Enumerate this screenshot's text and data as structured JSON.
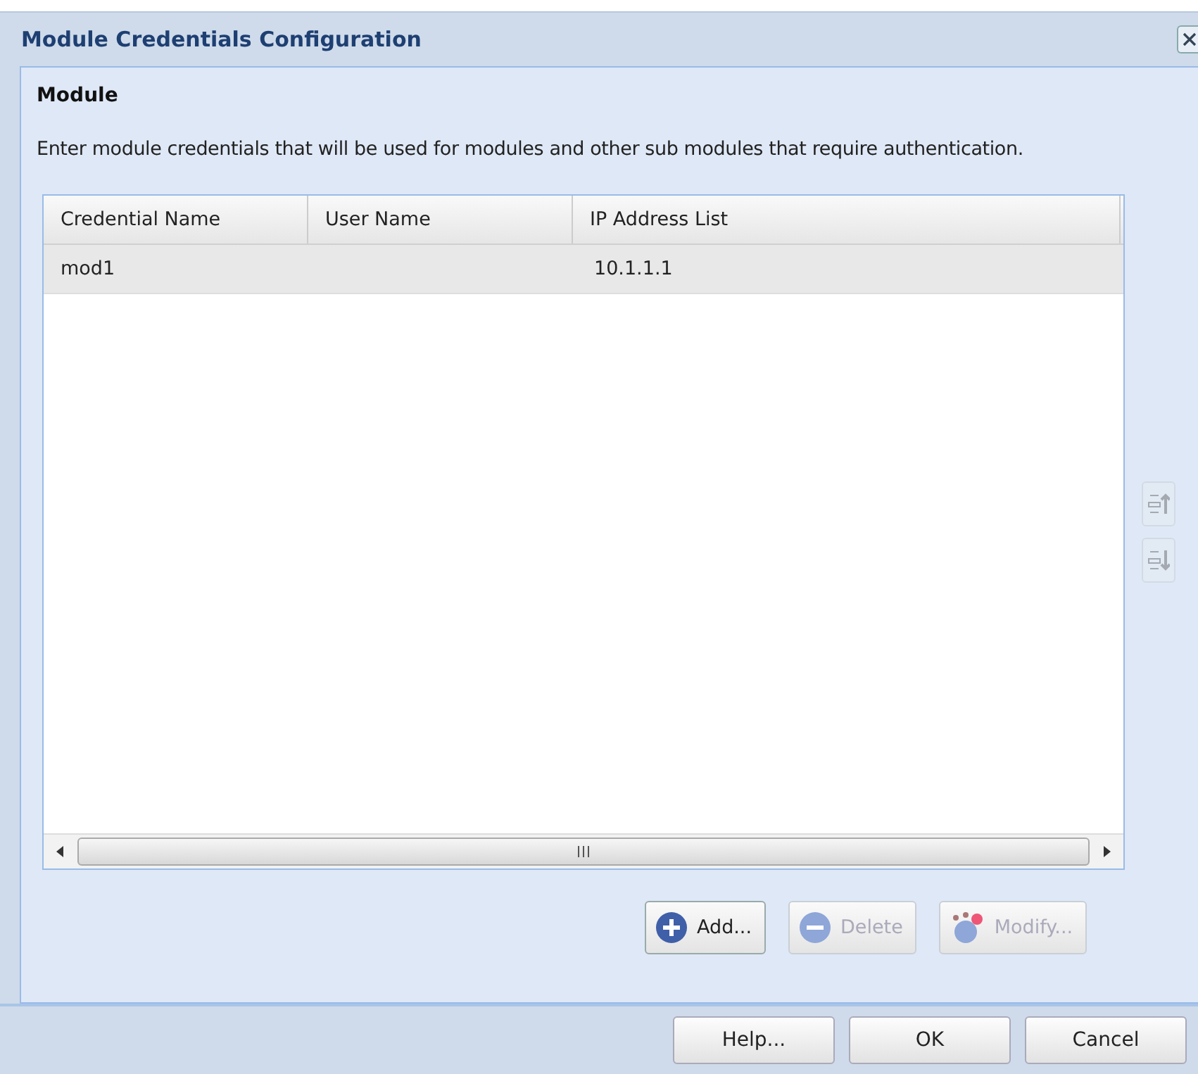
{
  "window": {
    "title": "Module Credentials Configuration"
  },
  "section": {
    "title": "Module",
    "description": "Enter module credentials that will be used for modules and other sub modules that require authentication."
  },
  "table": {
    "columns": [
      "Credential Name",
      "User Name",
      "IP Address List"
    ],
    "rows": [
      {
        "cells": [
          "mod1",
          "",
          "10.1.1.1"
        ],
        "selected": true
      }
    ]
  },
  "move_buttons": [
    {
      "kind": "up",
      "disabled": true
    },
    {
      "kind": "down",
      "disabled": true
    }
  ],
  "actions": [
    {
      "kind": "add",
      "label": "Add...",
      "disabled": false
    },
    {
      "kind": "delete",
      "label": "Delete",
      "disabled": true
    },
    {
      "kind": "modify",
      "label": "Modify...",
      "disabled": true
    }
  ],
  "footer_buttons": [
    "Help...",
    "OK",
    "Cancel"
  ]
}
